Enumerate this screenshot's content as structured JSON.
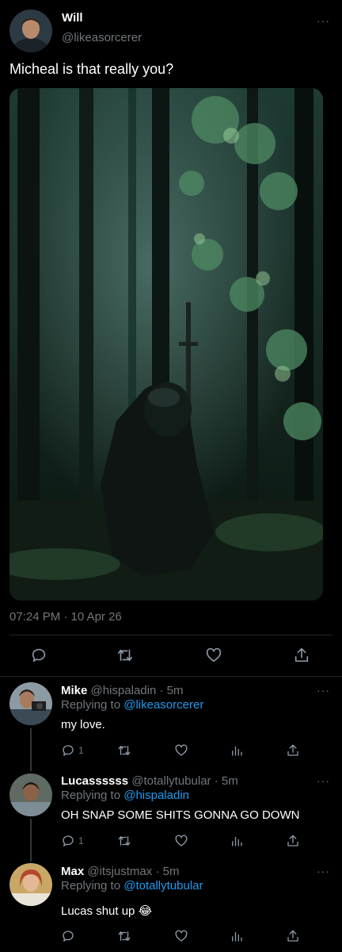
{
  "tweet": {
    "name": "Will",
    "handle": "@likeasorcerer",
    "text": "Micheal is that really you?",
    "timestamp": "07:24 PM · 10 Apr 26"
  },
  "replies": [
    {
      "name": "Mike",
      "handle": "@hispaladin",
      "time": "· 5m",
      "replying_prefix": "Replying to ",
      "replying_to": "@likeasorcerer",
      "text": "my love.",
      "reply_count": "1"
    },
    {
      "name": "Lucassssss",
      "handle": "@totallytubular",
      "time": "· 5m",
      "replying_prefix": "Replying to ",
      "replying_to": "@hispaladin",
      "text": "OH SNAP SOME SHITS GONNA GO DOWN",
      "reply_count": "1"
    },
    {
      "name": "Max",
      "handle": "@itsjustmax",
      "time": "· 5m",
      "replying_prefix": "Replying to ",
      "replying_to": "@totallytubular",
      "text": "Lucas shut up 😂",
      "reply_count": ""
    }
  ],
  "more_label": "···",
  "colors": {
    "background": "#000000",
    "accent": "#1d9bf0",
    "muted": "#71767b"
  },
  "icons": [
    "reply-icon",
    "retweet-icon",
    "like-icon",
    "share-icon",
    "views-icon",
    "more-icon"
  ]
}
